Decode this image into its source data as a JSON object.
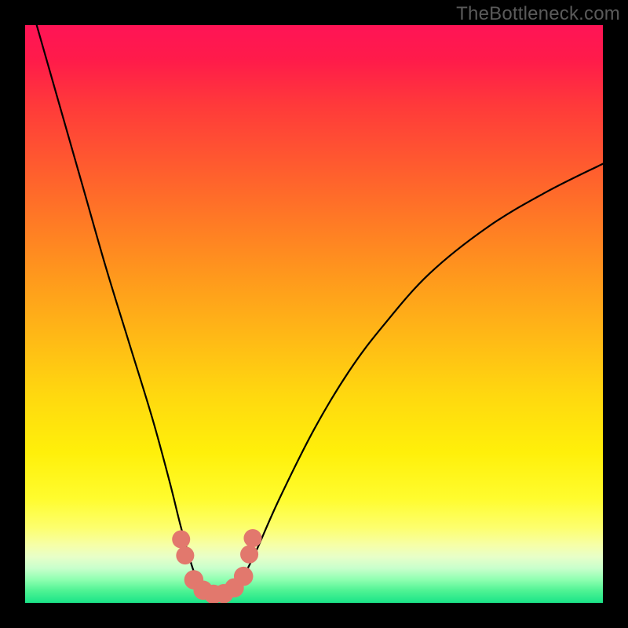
{
  "watermark": "TheBottleneck.com",
  "chart_data": {
    "type": "line",
    "title": "",
    "xlabel": "",
    "ylabel": "",
    "xlim": [
      0,
      100
    ],
    "ylim": [
      0,
      100
    ],
    "series": [
      {
        "name": "bottleneck-curve",
        "x": [
          2,
          6,
          10,
          14,
          18,
          22,
          25,
          27,
          29,
          30.5,
          32,
          34,
          36,
          38,
          40,
          44,
          50,
          56,
          62,
          70,
          80,
          90,
          100
        ],
        "y": [
          100,
          86,
          72,
          58,
          45,
          32,
          21,
          13,
          6,
          2.5,
          1,
          1,
          2,
          5,
          9,
          18,
          30,
          40,
          48,
          57,
          65,
          71,
          76
        ]
      }
    ],
    "markers": {
      "name": "highlight-dots",
      "color": "#e2786d",
      "points": [
        {
          "x": 27.0,
          "y": 11.0,
          "r": 1.5
        },
        {
          "x": 27.7,
          "y": 8.2,
          "r": 1.5
        },
        {
          "x": 29.2,
          "y": 4.0,
          "r": 1.7
        },
        {
          "x": 30.8,
          "y": 2.2,
          "r": 1.7
        },
        {
          "x": 32.6,
          "y": 1.5,
          "r": 1.7
        },
        {
          "x": 34.4,
          "y": 1.6,
          "r": 1.7
        },
        {
          "x": 36.2,
          "y": 2.6,
          "r": 1.7
        },
        {
          "x": 37.8,
          "y": 4.6,
          "r": 1.7
        },
        {
          "x": 38.8,
          "y": 8.4,
          "r": 1.5
        },
        {
          "x": 39.4,
          "y": 11.2,
          "r": 1.5
        }
      ]
    },
    "gradient_stops": [
      {
        "pos": 0.0,
        "color": "#ff1456"
      },
      {
        "pos": 0.5,
        "color": "#ffc412"
      },
      {
        "pos": 0.82,
        "color": "#fffc2e"
      },
      {
        "pos": 1.0,
        "color": "#1ae488"
      }
    ]
  }
}
